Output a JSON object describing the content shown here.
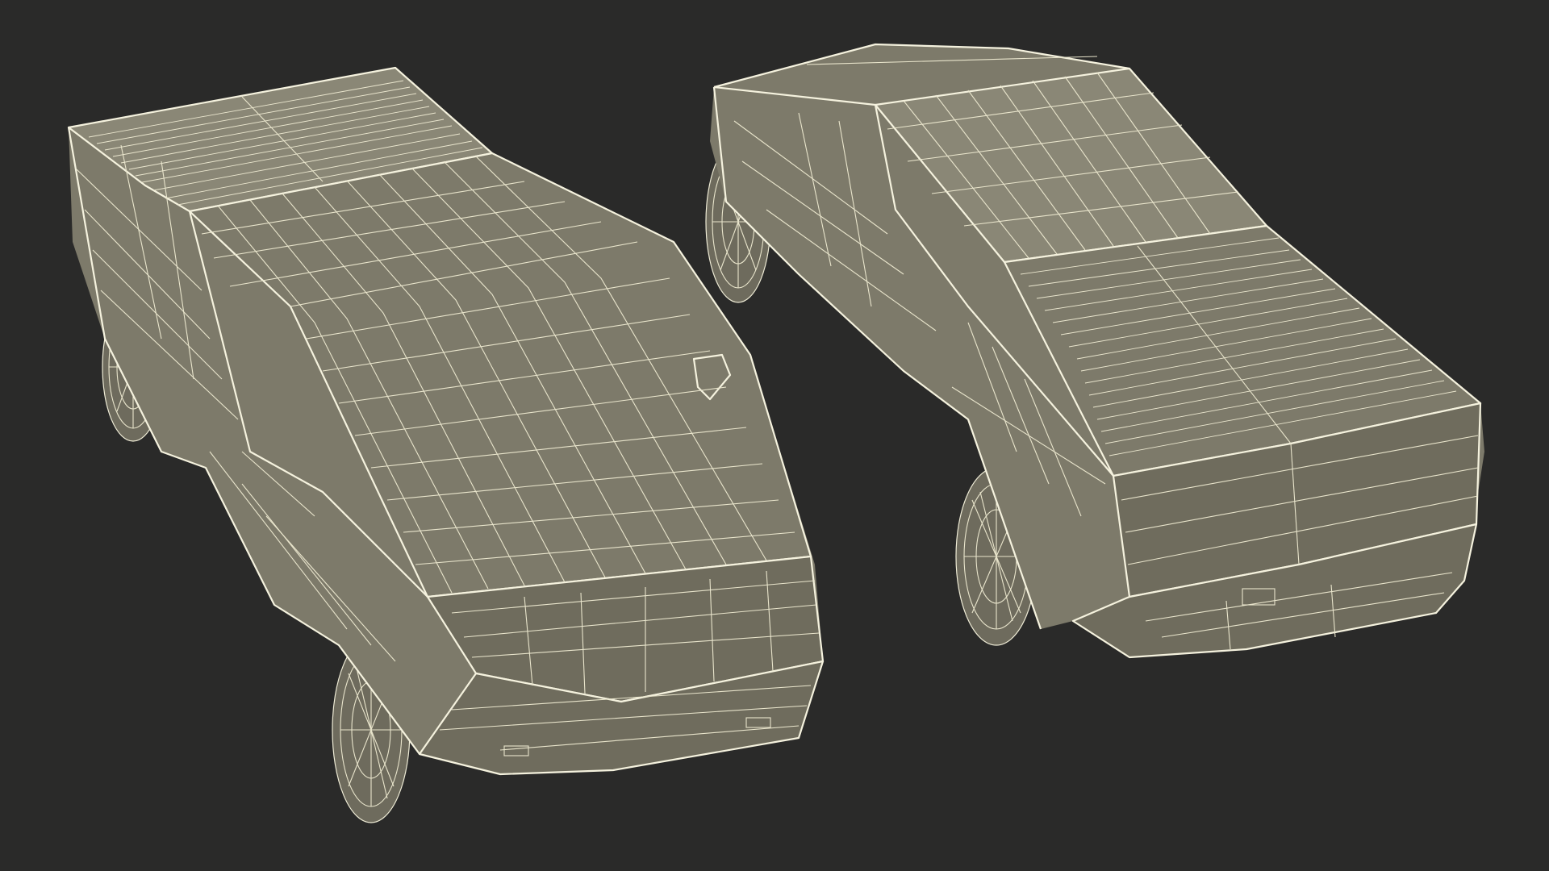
{
  "scene": {
    "background": "#2a2a29",
    "mesh_fill": "#7d7a6a",
    "wire_color": "#f1eed8",
    "render_mode": "wireframe-over-shaded",
    "objects": [
      {
        "name": "pickup-truck-front-view"
      },
      {
        "name": "pickup-truck-rear-view"
      }
    ]
  }
}
